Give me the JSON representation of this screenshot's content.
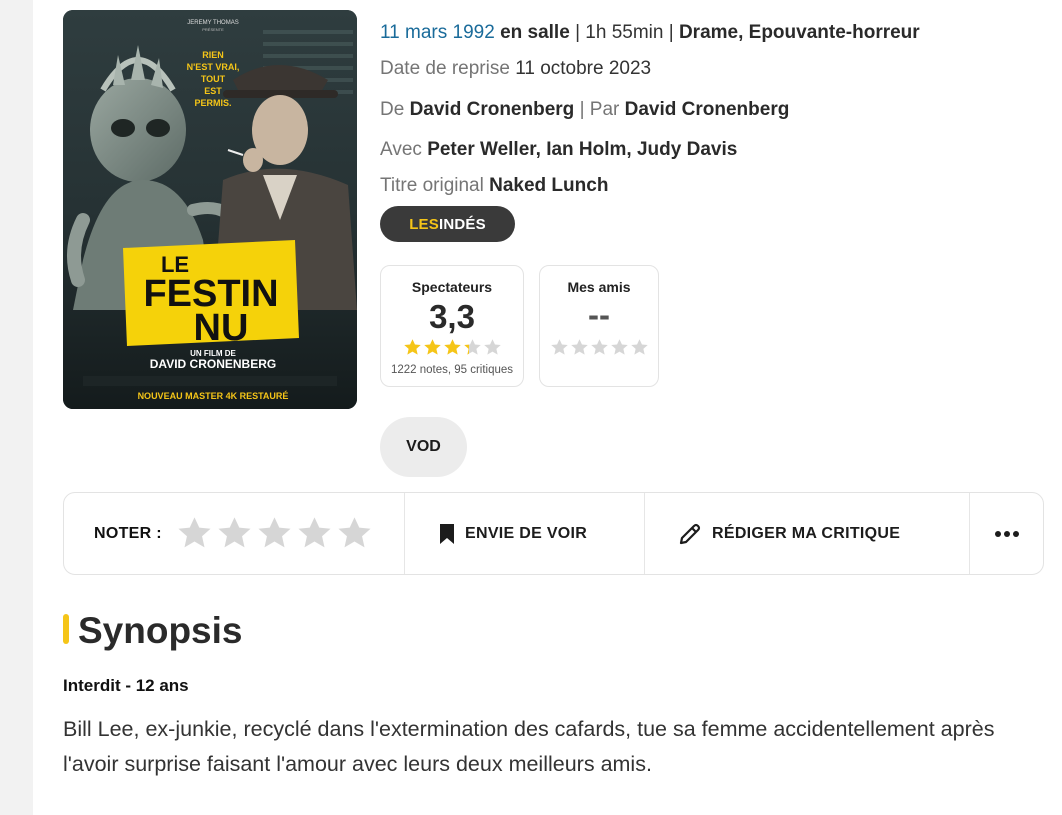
{
  "movie": {
    "release_date": "11 mars 1992",
    "release_context": "en salle",
    "separator": "|",
    "duration": "1h 55min",
    "genres": "Drame, Epouvante-horreur",
    "reissue_label": "Date de reprise",
    "reissue_date": "11 octobre 2023",
    "director_prefix": "De",
    "director": "David Cronenberg",
    "writer_prefix": "Par",
    "writer": "David Cronenberg",
    "cast_prefix": "Avec",
    "cast": [
      "Peter Weller",
      "Ian Holm",
      "Judy Davis"
    ],
    "original_title_label": "Titre original",
    "original_title": "Naked Lunch"
  },
  "poster": {
    "top_credit": "JEREMY THOMAS",
    "top_credit_sub": "PRÉSENTE",
    "tagline": [
      "RIEN",
      "N'EST VRAI,",
      "TOUT",
      "EST",
      "PERMIS."
    ],
    "title_line1": "LE",
    "title_line2": "FESTIN",
    "title_line3": "NU",
    "film_by": "UN FILM DE",
    "director": "DAVID CRONENBERG",
    "footer": "NOUVEAU MASTER 4K RESTAURÉ"
  },
  "distributor": {
    "part1": "LES",
    "part2": "INDÉS"
  },
  "ratings": {
    "spectators": {
      "title": "Spectateurs",
      "value": "3,3",
      "score": 3.3,
      "max": 5,
      "count": "1222 notes, 95 critiques"
    },
    "friends": {
      "title": "Mes amis",
      "value": "--",
      "score": 0,
      "max": 5
    }
  },
  "vod": {
    "label": "VOD"
  },
  "actions": {
    "rate_label": "NOTER :",
    "rate_stars": 5,
    "watchlist_label": "ENVIE DE VOIR",
    "review_label": "RÉDIGER MA CRITIQUE",
    "more_icon": "more-dots-icon"
  },
  "synopsis": {
    "title": "Synopsis",
    "rating": "Interdit - 12 ans",
    "text": "Bill Lee, ex-junkie, recyclé dans l'extermination des cafards, tue sa femme accidentellement après l'avoir surprise faisant l'amour avec leurs deux meilleurs amis."
  },
  "colors": {
    "accent_yellow": "#f5c518",
    "link_blue": "#1a6b9a",
    "star_filled": "#f5c518",
    "star_empty": "#d6d6d6",
    "badge_dark": "#3a3a3a"
  }
}
